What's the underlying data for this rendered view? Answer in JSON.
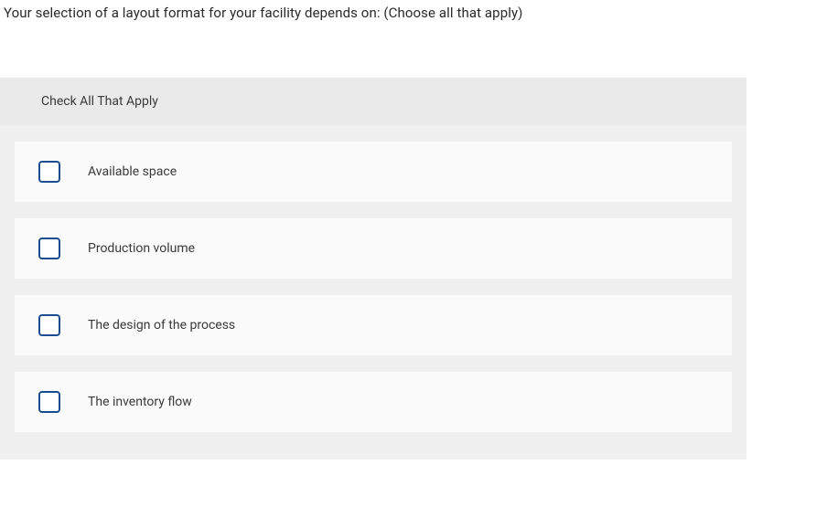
{
  "question": {
    "text": "Your selection of a layout format for your facility depends on: (Choose all that apply)"
  },
  "instruction": "Check All That Apply",
  "options": [
    {
      "label": "Available space",
      "checked": false
    },
    {
      "label": "Production volume",
      "checked": false
    },
    {
      "label": "The design of the process",
      "checked": false
    },
    {
      "label": "The inventory flow",
      "checked": false
    }
  ]
}
